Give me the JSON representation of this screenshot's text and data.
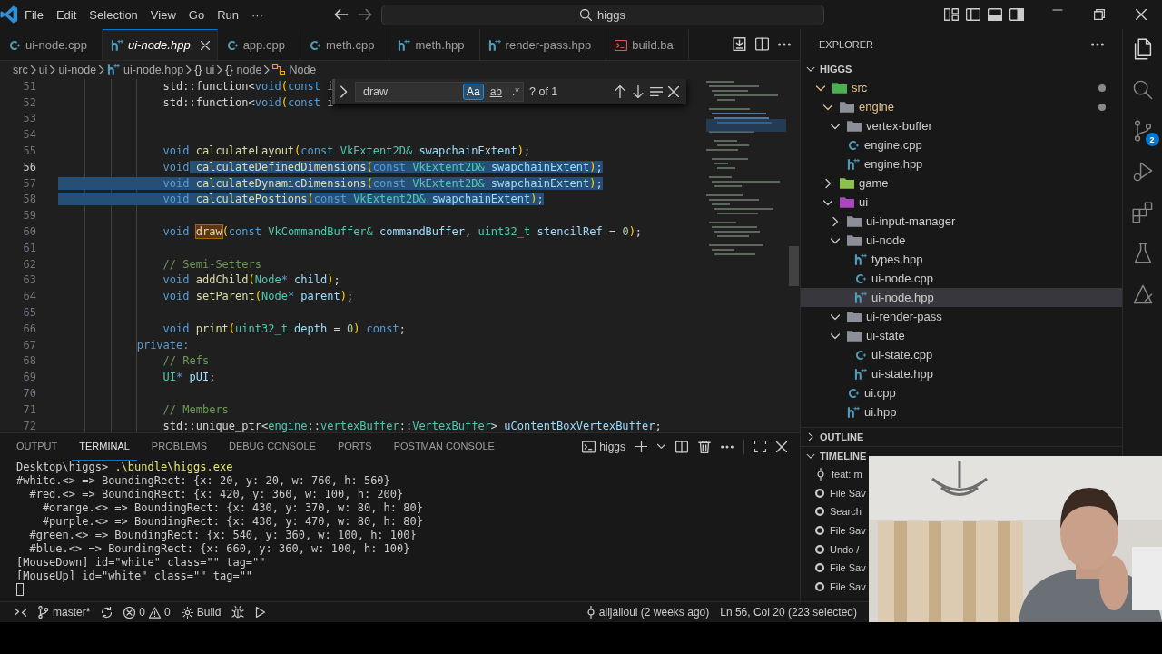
{
  "title_bar": {
    "menus": [
      "File",
      "Edit",
      "Selection",
      "View",
      "Go",
      "Run",
      "···"
    ],
    "search": "higgs"
  },
  "editor_tabs": [
    {
      "label": "ui-node.cpp",
      "kind": "cpp",
      "selected": false,
      "preview": false
    },
    {
      "label": "ui-node.hpp",
      "kind": "hpp",
      "selected": true,
      "preview": true
    },
    {
      "label": "app.cpp",
      "kind": "cpp",
      "selected": false,
      "preview": false
    },
    {
      "label": "meth.cpp",
      "kind": "cpp",
      "selected": false,
      "preview": false
    },
    {
      "label": "meth.hpp",
      "kind": "hpp",
      "selected": false,
      "preview": false
    },
    {
      "label": "render-pass.hpp",
      "kind": "hpp",
      "selected": false,
      "preview": false
    },
    {
      "label": "build.ba",
      "kind": "bat",
      "selected": false,
      "preview": false
    }
  ],
  "breadcrumbs": [
    {
      "label": "src",
      "kind": "folder"
    },
    {
      "label": "ui",
      "kind": "folder"
    },
    {
      "label": "ui-node",
      "kind": "folder"
    },
    {
      "label": "ui-node.hpp",
      "kind": "hpp"
    },
    {
      "label": "ui",
      "kind": "namespace",
      "icon": "{}"
    },
    {
      "label": "node",
      "kind": "namespace",
      "icon": "{}"
    },
    {
      "label": "Node",
      "kind": "class"
    }
  ],
  "find_widget": {
    "value": "draw",
    "result": "? of 1",
    "options": [
      {
        "label": "Aa",
        "kind": "case",
        "selected": true
      },
      {
        "label": "ab",
        "kind": "word",
        "selected": false
      },
      {
        "label": ".*",
        "kind": "regex",
        "selected": false
      }
    ]
  },
  "code_lines": [
    {
      "number": "51",
      "current": false,
      "tokens": [
        {
          "text": "                std::function<",
          "kind": "plain"
        },
        {
          "text": "void",
          "kind": "keyword"
        },
        {
          "text": "(",
          "kind": "bracket"
        },
        {
          "text": "const",
          "kind": "keyword"
        },
        {
          "text": " i",
          "kind": "plain"
        }
      ]
    },
    {
      "number": "52",
      "current": false,
      "tokens": [
        {
          "text": "                std::function<",
          "kind": "plain"
        },
        {
          "text": "void",
          "kind": "keyword"
        },
        {
          "text": "(",
          "kind": "bracket"
        },
        {
          "text": "const",
          "kind": "keyword"
        },
        {
          "text": " i",
          "kind": "plain"
        }
      ]
    },
    {
      "number": "53",
      "current": false
    },
    {
      "number": "54",
      "current": false
    },
    {
      "number": "55",
      "current": false,
      "tokens": [
        {
          "text": "                void ",
          "kind": "keyword"
        },
        {
          "text": "calculateLayout",
          "kind": "function"
        },
        {
          "text": "(",
          "kind": "bracket"
        },
        {
          "text": "const ",
          "kind": "keyword"
        },
        {
          "text": "VkExtent2D& ",
          "kind": "type"
        },
        {
          "text": "swapchainExtent",
          "kind": "param"
        },
        {
          "text": ")",
          "kind": "bracket"
        },
        {
          "text": ";",
          "kind": "plain"
        }
      ]
    },
    {
      "number": "56",
      "current": true,
      "tokens": [
        {
          "text": "                void",
          "kind": "keyword",
          "selected": false
        },
        {
          "text": " calculateDefinedDimensions",
          "kind": "function",
          "selected": true
        },
        {
          "text": "(",
          "kind": "bracket",
          "selected": true
        },
        {
          "text": "const ",
          "kind": "keyword",
          "selected": true
        },
        {
          "text": "VkExtent2D& ",
          "kind": "type",
          "selected": true
        },
        {
          "text": "swapchainExtent",
          "kind": "param",
          "selected": true
        },
        {
          "text": ")",
          "kind": "bracket",
          "selected": true
        },
        {
          "text": ";",
          "kind": "plain",
          "selected": true
        }
      ]
    },
    {
      "number": "57",
      "current": false,
      "tokens": [
        {
          "text": "                void ",
          "kind": "keyword",
          "selected": true
        },
        {
          "text": "calculateDynamicDimensions",
          "kind": "function",
          "selected": true
        },
        {
          "text": "(",
          "kind": "bracket",
          "selected": true
        },
        {
          "text": "const ",
          "kind": "keyword",
          "selected": true
        },
        {
          "text": "VkExtent2D& ",
          "kind": "type",
          "selected": true
        },
        {
          "text": "swapchainExtent",
          "kind": "param",
          "selected": true
        },
        {
          "text": ")",
          "kind": "bracket",
          "selected": true
        },
        {
          "text": ";",
          "kind": "plain",
          "selected": true
        }
      ]
    },
    {
      "number": "58",
      "current": false,
      "tokens": [
        {
          "text": "                void ",
          "kind": "keyword",
          "selected": true
        },
        {
          "text": "calculatePostions",
          "kind": "function",
          "selected": true
        },
        {
          "text": "(",
          "kind": "bracket",
          "selected": true
        },
        {
          "text": "const ",
          "kind": "keyword",
          "selected": true
        },
        {
          "text": "VkExtent2D& ",
          "kind": "type",
          "selected": true
        },
        {
          "text": "swapchainExtent",
          "kind": "param",
          "selected": true
        },
        {
          "text": ")",
          "kind": "bracket",
          "selected": true
        },
        {
          "text": ";",
          "kind": "plain",
          "selected": true
        }
      ]
    },
    {
      "number": "59",
      "current": false
    },
    {
      "number": "60",
      "current": false,
      "tokens": [
        {
          "text": "                void ",
          "kind": "keyword"
        },
        {
          "text": "draw",
          "kind": "function",
          "match": true
        },
        {
          "text": "(",
          "kind": "bracket"
        },
        {
          "text": "const ",
          "kind": "keyword"
        },
        {
          "text": "VkCommandBuffer& ",
          "kind": "type"
        },
        {
          "text": "commandBuffer",
          "kind": "param"
        },
        {
          "text": ", ",
          "kind": "plain"
        },
        {
          "text": "uint32_t ",
          "kind": "type"
        },
        {
          "text": "stencilRef",
          "kind": "param"
        },
        {
          "text": " = ",
          "kind": "plain"
        },
        {
          "text": "0",
          "kind": "number"
        },
        {
          "text": ")",
          "kind": "bracket"
        },
        {
          "text": ";",
          "kind": "plain"
        }
      ]
    },
    {
      "number": "61",
      "current": false
    },
    {
      "number": "62",
      "current": false,
      "tokens": [
        {
          "text": "                // Semi-Setters",
          "kind": "comment"
        }
      ]
    },
    {
      "number": "63",
      "current": false,
      "tokens": [
        {
          "text": "                void ",
          "kind": "keyword"
        },
        {
          "text": "addChild",
          "kind": "function"
        },
        {
          "text": "(",
          "kind": "bracket"
        },
        {
          "text": "Node",
          "kind": "type"
        },
        {
          "text": "* ",
          "kind": "keyword"
        },
        {
          "text": "child",
          "kind": "param"
        },
        {
          "text": ")",
          "kind": "bracket"
        },
        {
          "text": ";",
          "kind": "plain"
        }
      ]
    },
    {
      "number": "64",
      "current": false,
      "tokens": [
        {
          "text": "                void ",
          "kind": "keyword"
        },
        {
          "text": "setParent",
          "kind": "function"
        },
        {
          "text": "(",
          "kind": "bracket"
        },
        {
          "text": "Node",
          "kind": "type"
        },
        {
          "text": "* ",
          "kind": "keyword"
        },
        {
          "text": "parent",
          "kind": "param"
        },
        {
          "text": ")",
          "kind": "bracket"
        },
        {
          "text": ";",
          "kind": "plain"
        }
      ]
    },
    {
      "number": "65",
      "current": false
    },
    {
      "number": "66",
      "current": false,
      "tokens": [
        {
          "text": "                void ",
          "kind": "keyword"
        },
        {
          "text": "print",
          "kind": "function"
        },
        {
          "text": "(",
          "kind": "bracket"
        },
        {
          "text": "uint32_t ",
          "kind": "type"
        },
        {
          "text": "depth",
          "kind": "param"
        },
        {
          "text": " = ",
          "kind": "plain"
        },
        {
          "text": "0",
          "kind": "number"
        },
        {
          "text": ")",
          "kind": "bracket"
        },
        {
          "text": " const",
          "kind": "keyword"
        },
        {
          "text": ";",
          "kind": "plain"
        }
      ]
    },
    {
      "number": "67",
      "current": false,
      "tokens": [
        {
          "text": "            private:",
          "kind": "keyword"
        }
      ]
    },
    {
      "number": "68",
      "current": false,
      "tokens": [
        {
          "text": "                // Refs",
          "kind": "comment"
        }
      ]
    },
    {
      "number": "69",
      "current": false,
      "tokens": [
        {
          "text": "                UI",
          "kind": "type"
        },
        {
          "text": "* ",
          "kind": "keyword"
        },
        {
          "text": "pUI",
          "kind": "param"
        },
        {
          "text": ";",
          "kind": "plain"
        }
      ]
    },
    {
      "number": "70",
      "current": false
    },
    {
      "number": "71",
      "current": false,
      "tokens": [
        {
          "text": "                // Members",
          "kind": "comment"
        }
      ]
    },
    {
      "number": "72",
      "current": false,
      "tokens": [
        {
          "text": "                std::unique_ptr<",
          "kind": "plain"
        },
        {
          "text": "engine",
          "kind": "type"
        },
        {
          "text": "::",
          "kind": "plain"
        },
        {
          "text": "vertexBuffer",
          "kind": "type"
        },
        {
          "text": "::",
          "kind": "plain"
        },
        {
          "text": "VertexBuffer",
          "kind": "type"
        },
        {
          "text": "> ",
          "kind": "plain"
        },
        {
          "text": "uContentBoxVertexBuffer",
          "kind": "param"
        },
        {
          "text": ";",
          "kind": "plain"
        }
      ]
    }
  ],
  "panel": {
    "tabs": [
      {
        "label": "OUTPUT",
        "selected": false
      },
      {
        "label": "TERMINAL",
        "selected": true
      },
      {
        "label": "PROBLEMS",
        "selected": false
      },
      {
        "label": "DEBUG CONSOLE",
        "selected": false
      },
      {
        "label": "PORTS",
        "selected": false
      },
      {
        "label": "POSTMAN CONSOLE",
        "selected": false
      }
    ],
    "terminal_name": "higgs",
    "terminal_lines": [
      {
        "kind": "prompt",
        "prompt": "Desktop\\higgs> ",
        "command": ".\\bundle\\higgs.exe"
      },
      {
        "kind": "output",
        "text": "#white.<> => BoundingRect: {x: 20, y: 20, w: 760, h: 560}"
      },
      {
        "kind": "output",
        "text": "  #red.<> => BoundingRect: {x: 420, y: 360, w: 100, h: 200}"
      },
      {
        "kind": "output",
        "text": "    #orange.<> => BoundingRect: {x: 430, y: 370, w: 80, h: 80}"
      },
      {
        "kind": "output",
        "text": "    #purple.<> => BoundingRect: {x: 430, y: 470, w: 80, h: 80}"
      },
      {
        "kind": "output",
        "text": "  #green.<> => BoundingRect: {x: 540, y: 360, w: 100, h: 100}"
      },
      {
        "kind": "output",
        "text": "  #blue.<> => BoundingRect: {x: 660, y: 360, w: 100, h: 100}"
      },
      {
        "kind": "output",
        "text": "[MouseDown] id=\"white\" class=\"\" tag=\"\""
      },
      {
        "kind": "output",
        "text": "[MouseUp] id=\"white\" class=\"\" tag=\"\""
      },
      {
        "kind": "cursor"
      }
    ]
  },
  "explorer": {
    "title": "EXPLORER",
    "root": {
      "label": "HIGGS",
      "expanded": true
    },
    "tree": [
      {
        "label": "src",
        "kind": "folder",
        "color": "#4caf50",
        "expanded": true,
        "selected": false,
        "modified": true,
        "children": [
          {
            "label": "engine",
            "kind": "folder",
            "color": "#8a8f98",
            "expanded": true,
            "selected": false,
            "modified": true,
            "children": [
              {
                "label": "vertex-buffer",
                "kind": "folder",
                "color": "#8a8f98",
                "expanded": true,
                "selected": false,
                "modified": false
              },
              {
                "label": "engine.cpp",
                "kind": "cpp",
                "selected": false,
                "modified": false
              },
              {
                "label": "engine.hpp",
                "kind": "hpp",
                "selected": false,
                "modified": false
              }
            ]
          },
          {
            "label": "game",
            "kind": "folder",
            "color": "#8bc34a",
            "expanded": false,
            "selected": false,
            "modified": false
          },
          {
            "label": "ui",
            "kind": "folder",
            "color": "#ab47bc",
            "expanded": true,
            "selected": false,
            "modified": false,
            "children": [
              {
                "label": "ui-input-manager",
                "kind": "folder",
                "color": "#8a8f98",
                "expanded": false,
                "selected": false,
                "modified": false
              },
              {
                "label": "ui-node",
                "kind": "folder",
                "color": "#8a8f98",
                "expanded": true,
                "selected": false,
                "modified": false,
                "children": [
                  {
                    "label": "types.hpp",
                    "kind": "hpp",
                    "selected": false,
                    "modified": false
                  },
                  {
                    "label": "ui-node.cpp",
                    "kind": "cpp",
                    "selected": false,
                    "modified": false
                  },
                  {
                    "label": "ui-node.hpp",
                    "kind": "hpp",
                    "selected": true,
                    "modified": false
                  }
                ]
              },
              {
                "label": "ui-render-pass",
                "kind": "folder",
                "color": "#8a8f98",
                "expanded": true,
                "selected": false,
                "modified": false
              },
              {
                "label": "ui-state",
                "kind": "folder",
                "color": "#8a8f98",
                "expanded": true,
                "selected": false,
                "modified": false,
                "children": [
                  {
                    "label": "ui-state.cpp",
                    "kind": "cpp",
                    "selected": false,
                    "modified": false
                  },
                  {
                    "label": "ui-state.hpp",
                    "kind": "hpp",
                    "selected": false,
                    "modified": false
                  }
                ]
              },
              {
                "label": "ui.cpp",
                "kind": "cpp",
                "selected": false,
                "modified": false
              },
              {
                "label": "ui.hpp",
                "kind": "hpp",
                "selected": false,
                "modified": false
              }
            ]
          }
        ]
      }
    ]
  },
  "outline": {
    "label": "OUTLINE",
    "expanded": false
  },
  "timeline": {
    "label": "TIMELINE",
    "expanded": true,
    "items": [
      {
        "kind": "commit",
        "label": "feat: m"
      },
      {
        "kind": "save",
        "label": "File Sav"
      },
      {
        "kind": "save",
        "label": "Search"
      },
      {
        "kind": "save",
        "label": "File Sav"
      },
      {
        "kind": "save",
        "label": "Undo /"
      },
      {
        "kind": "save",
        "label": "File Sav"
      },
      {
        "kind": "save",
        "label": "File Sav"
      }
    ]
  },
  "activity_bar": [
    {
      "kind": "explorer",
      "selected": true
    },
    {
      "kind": "search",
      "selected": false
    },
    {
      "kind": "source-control",
      "selected": false,
      "badge": "2"
    },
    {
      "kind": "run-debug",
      "selected": false
    },
    {
      "kind": "extensions",
      "selected": false
    },
    {
      "kind": "testing",
      "selected": false
    },
    {
      "kind": "tool",
      "selected": false
    }
  ],
  "status_bar": {
    "branch": "master*",
    "errors": "0",
    "warnings": "0",
    "task": "Build",
    "blame": "alijalloul (2 weeks ago)",
    "position": "Ln 56, Col 20 (223 selected)"
  }
}
